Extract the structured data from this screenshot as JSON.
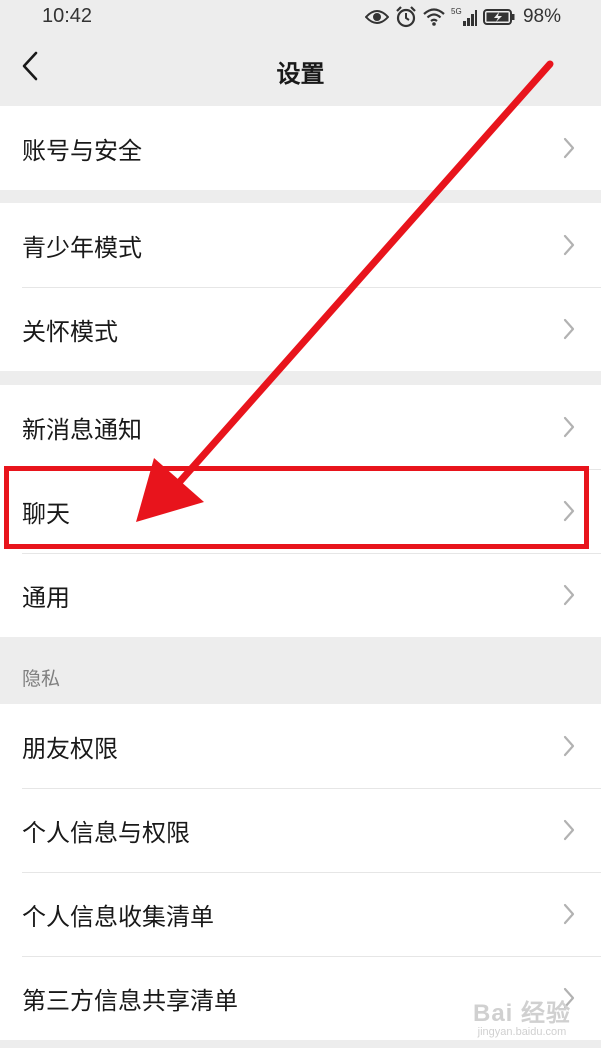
{
  "status_bar": {
    "time": "10:42",
    "battery_percent": "98%",
    "icons": [
      "eye-icon",
      "alarm-icon",
      "wifi-icon",
      "cellular-5g-icon",
      "battery-charging-icon"
    ]
  },
  "nav": {
    "title": "设置",
    "back_icon": "chevron-left-icon"
  },
  "groups": [
    {
      "items": [
        {
          "label": "账号与安全"
        }
      ]
    },
    {
      "items": [
        {
          "label": "青少年模式"
        },
        {
          "label": "关怀模式"
        }
      ]
    },
    {
      "items": [
        {
          "label": "新消息通知"
        },
        {
          "label": "聊天"
        },
        {
          "label": "通用"
        }
      ]
    },
    {
      "header": "隐私",
      "items": [
        {
          "label": "朋友权限"
        },
        {
          "label": "个人信息与权限"
        },
        {
          "label": "个人信息收集清单"
        },
        {
          "label": "第三方信息共享清单"
        }
      ]
    }
  ],
  "annotation": {
    "highlighted_item": "聊天",
    "color": "#e8141c"
  },
  "watermark": {
    "logo": "Bai 经验",
    "url": "jingyan.baidu.com"
  }
}
